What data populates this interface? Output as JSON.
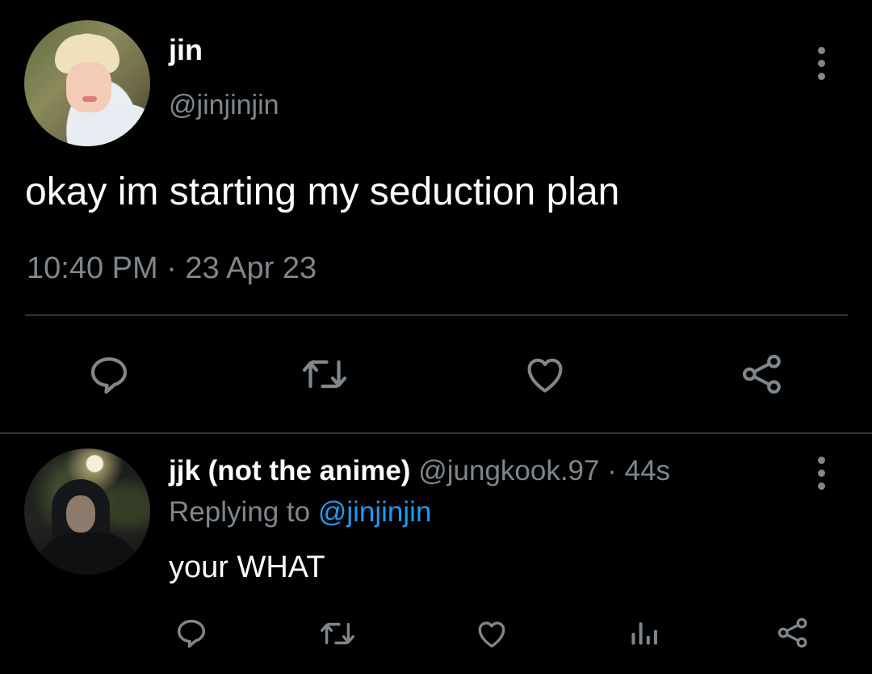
{
  "main_tweet": {
    "display_name": "jin",
    "handle": "@jinjinjin",
    "text": "okay im starting my seduction plan",
    "timestamp": "10:40 PM · 23 Apr 23",
    "actions": [
      "reply-icon",
      "retweet-icon",
      "like-icon",
      "share-icon"
    ]
  },
  "reply_tweet": {
    "display_name": "jjk (not the anime)",
    "handle": "@jungkook.97",
    "separator": " · ",
    "time_ago": "44s",
    "replying_prefix": "Replying to ",
    "replying_handle": "@jinjinjin",
    "text": "your WHAT",
    "actions": [
      "reply-icon",
      "retweet-icon",
      "like-icon",
      "analytics-icon",
      "share-icon"
    ]
  },
  "colors": {
    "background": "#000000",
    "primary_text": "#ffffff",
    "secondary_text": "#7f868c",
    "link": "#1d9bf0",
    "divider": "#2f3336"
  }
}
